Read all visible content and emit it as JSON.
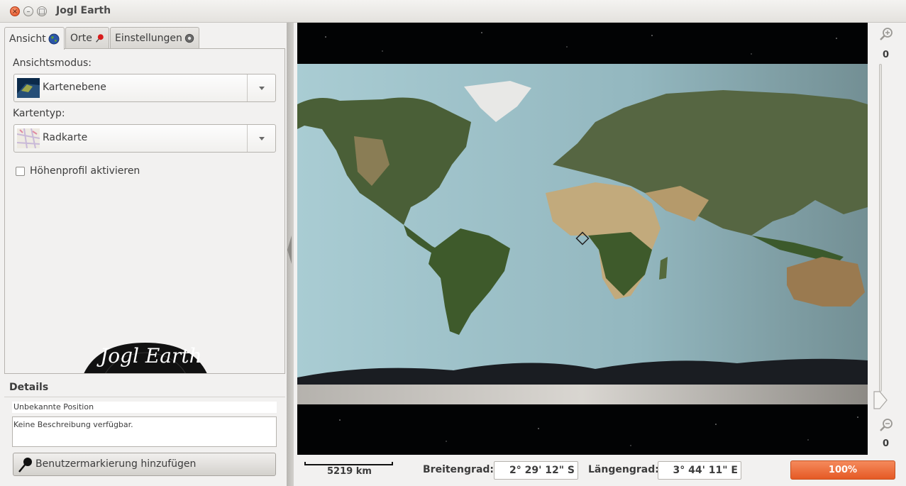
{
  "window": {
    "title": "Jogl Earth",
    "close_glyph": "×",
    "minimize_glyph": "–",
    "maximize_glyph": "□"
  },
  "tabs": [
    {
      "label": "Ansicht",
      "icon": "globe-icon",
      "active": true
    },
    {
      "label": "Orte",
      "icon": "pin-icon",
      "active": false
    },
    {
      "label": "Einstellungen",
      "icon": "gear-icon",
      "active": false
    }
  ],
  "view_settings": {
    "mode_label": "Ansichtsmodus:",
    "mode_value": "Kartenebene",
    "map_type_label": "Kartentyp:",
    "map_type_value": "Radkarte",
    "elevation_label": "Höhenprofil aktivieren",
    "elevation_checked": false
  },
  "logo": {
    "text": "Jogl Earth"
  },
  "details": {
    "title": "Details",
    "position": "Unbekannte Position",
    "description": "Keine Beschreibung verfügbar.",
    "add_marker_label": "Benutzermarkierung hinzufügen"
  },
  "zoom": {
    "top_value": "0",
    "bottom_value": "0"
  },
  "status": {
    "scale": "5219 km",
    "lat_label": "Breitengrad:",
    "lat_value": "2° 29' 12\" S",
    "lon_label": "Längengrad:",
    "lon_value": "3° 44' 11\" E",
    "progress": "100%",
    "progress_fraction": 1.0
  },
  "colors": {
    "accent": "#e55a25",
    "ocean": "#9fbfc6",
    "space": "#020304"
  }
}
